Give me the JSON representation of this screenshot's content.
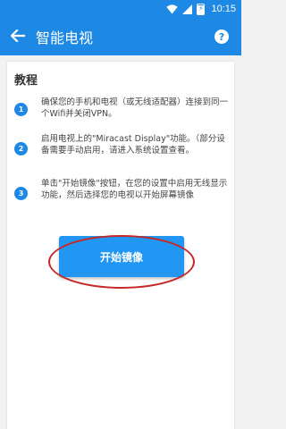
{
  "status_bar": {
    "time": "10:15",
    "battery_glyph": "⚡",
    "battery_level": 0.9,
    "icons": [
      "wifi-icon",
      "signal-icon",
      "battery-charging-icon"
    ]
  },
  "app_bar": {
    "title": "智能电视",
    "help_label": "?",
    "back_icon": "arrow-left-icon"
  },
  "tutorial": {
    "title": "教程",
    "steps": [
      {
        "num": "1",
        "text": "确保您的手机和电视（或无线适配器）连接到同一个Wifi并关闭VPN。"
      },
      {
        "num": "2",
        "text": "启用电视上的\"Miracast Display\"功能。（部分设备需要手动启用，请进入系统设置查看。"
      },
      {
        "num": "3",
        "text": "单击\"开始镜像\"按钮，在您的设置中启用无线显示功能，然后选择您的电视以开始屏幕镜像"
      }
    ]
  },
  "start_button": {
    "label": "开始镜像"
  },
  "colors": {
    "primary": "#1e88e5",
    "button": "#2196f3",
    "highlight": "#c62828"
  }
}
